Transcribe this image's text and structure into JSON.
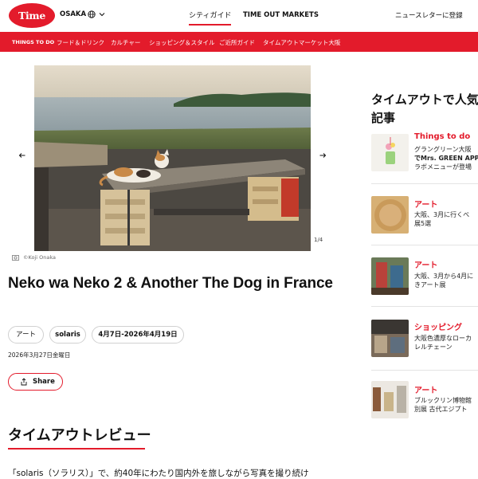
{
  "header": {
    "logo_text": "Time Out",
    "city": "OSAKA",
    "nav_city_guide": "シティガイド",
    "nav_markets": "TIME OUT MARKETS",
    "newsletter": "ニュースレターに登録"
  },
  "subnav": [
    {
      "label": "THINGS TO DO"
    },
    {
      "label": "フード＆ドリンク"
    },
    {
      "label": "カルチャー"
    },
    {
      "label": "ショッピング＆スタイル"
    },
    {
      "label": "ご近所ガイド"
    },
    {
      "label": "タイムアウトマーケット大阪"
    }
  ],
  "gallery": {
    "counter": "1/4",
    "credit": "©Koji Onaka"
  },
  "article": {
    "title": "Neko wa Neko 2 & Another The Dog in France",
    "tags": [
      "アート",
      "solaris",
      "4月7日-2026年4月19日"
    ],
    "date": "2026年3月27日金曜日",
    "share_label": "Share",
    "review_heading": "タイムアウトレビュー",
    "body_first_line": "「solaris（ソラリス）」で、約40年にわたり国内外を旅しながら写真を撮り続け"
  },
  "sidebar": {
    "title_line1": "タイムアウトで人気",
    "title_line2": "記事",
    "cards": [
      {
        "category": "Things to do",
        "lines": [
          "グラングリーン大阪",
          "でMrs. GREEN APPL",
          "ラボメニューが登場"
        ]
      },
      {
        "category": "アート",
        "lines": [
          "大阪、3月に行くべ",
          "展5選"
        ]
      },
      {
        "category": "アート",
        "lines": [
          "大阪、3月から4月に",
          "きアート展"
        ]
      },
      {
        "category": "ショッピング",
        "lines": [
          "大阪色濃厚なローカ",
          "レルチェーン"
        ]
      },
      {
        "category": "アート",
        "lines": [
          "ブルックリン博物館",
          "別展 古代エジプト"
        ]
      }
    ]
  },
  "colors": {
    "brand_red": "#e31b2b"
  }
}
